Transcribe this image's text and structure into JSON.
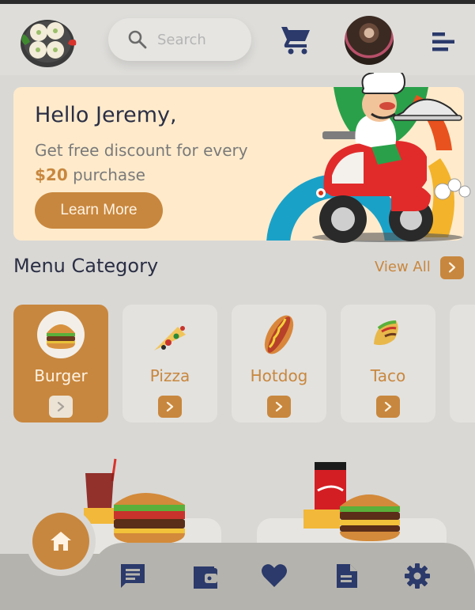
{
  "header": {
    "search_placeholder": "Search",
    "logo_icon": "dumpling-plate-logo",
    "cart_icon": "cart-icon",
    "avatar_icon": "user-avatar",
    "menu_icon": "menu-icon"
  },
  "banner": {
    "greeting": "Hello Jeremy,",
    "line1": "Get free discount for every",
    "amount": "$20",
    "line2_suffix": " purchase",
    "button_label": "Learn More"
  },
  "menu": {
    "title": "Menu Category",
    "view_all": "View All",
    "categories": [
      {
        "label": "Burger",
        "active": true
      },
      {
        "label": "Pizza",
        "active": false
      },
      {
        "label": "Hotdog",
        "active": false
      },
      {
        "label": "Taco",
        "active": false
      }
    ]
  },
  "nav": {
    "items": [
      "home-icon",
      "chat-icon",
      "wallet-icon",
      "heart-icon",
      "document-icon",
      "settings-icon"
    ]
  },
  "colors": {
    "accent": "#c8873e",
    "dark": "#2b2f45",
    "background": "#d9d8d5",
    "banner_bg": "#ffebcc"
  }
}
